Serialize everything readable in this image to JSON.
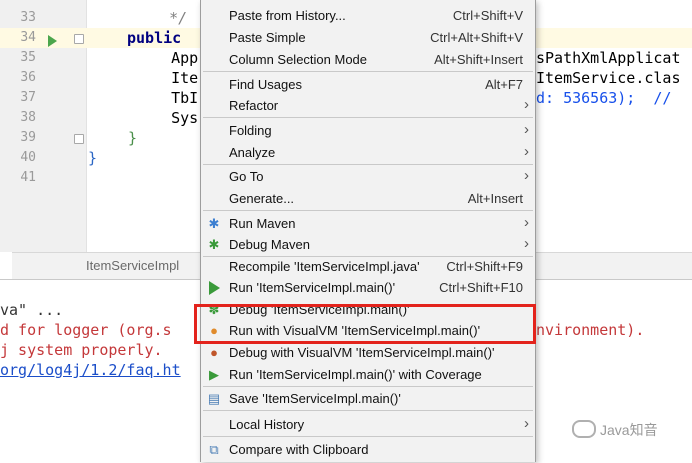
{
  "editor": {
    "lines": [
      {
        "num": "33",
        "code": "   */",
        "color": "#808080"
      },
      {
        "num": "34",
        "code": "public ",
        "color": "#000080"
      },
      {
        "num": "35",
        "code": "    App",
        "color": "#000000"
      },
      {
        "num": "36",
        "code": "    Ite",
        "color": "#000000"
      },
      {
        "num": "37",
        "code": "    TbI",
        "color": "#000000"
      },
      {
        "num": "38",
        "code": "    Sys",
        "color": "#000000"
      },
      {
        "num": "39",
        "code": "  }",
        "color": "#000000"
      },
      {
        "num": "40",
        "code": "}",
        "color": "#000000"
      },
      {
        "num": "41",
        "code": "",
        "color": "#000000"
      }
    ],
    "right_fragments": {
      "line35": "sPathXmlApplicat",
      "line36": "ItemService.clas",
      "line37": "d: 536563);  //"
    },
    "breadcrumb": "ItemServiceImpl"
  },
  "console": {
    "lines": [
      {
        "text": "va\" ...",
        "kind": "normal"
      },
      {
        "text": "d for logger (org.s",
        "kind": "error"
      },
      {
        "text": "j system properly.",
        "kind": "error"
      },
      {
        "text": "org/log4j/1.2/faq.ht",
        "kind": "link"
      }
    ],
    "right_fragment": "nvironment)."
  },
  "context_menu": {
    "items": [
      {
        "label": "Paste from History...",
        "shortcut": "Ctrl+Shift+V"
      },
      {
        "label": "Paste Simple",
        "shortcut": "Ctrl+Alt+Shift+V"
      },
      {
        "label": "Column Selection Mode",
        "shortcut": "Alt+Shift+Insert"
      },
      {
        "label": "Find Usages",
        "shortcut": "Alt+F7"
      },
      {
        "label": "Refactor",
        "shortcut": ""
      },
      {
        "label": "Folding",
        "shortcut": ""
      },
      {
        "label": "Analyze",
        "shortcut": ""
      },
      {
        "label": "Go To",
        "shortcut": ""
      },
      {
        "label": "Generate...",
        "shortcut": "Alt+Insert"
      },
      {
        "label": "Run Maven",
        "shortcut": ""
      },
      {
        "label": "Debug Maven",
        "shortcut": ""
      },
      {
        "label": "Recompile 'ItemServiceImpl.java'",
        "shortcut": "Ctrl+Shift+F9"
      },
      {
        "label": "Run 'ItemServiceImpl.main()'",
        "shortcut": "Ctrl+Shift+F10"
      },
      {
        "label": "Debug 'ItemServiceImpl.main()'",
        "shortcut": ""
      },
      {
        "label": "Run with VisualVM 'ItemServiceImpl.main()'",
        "shortcut": ""
      },
      {
        "label": "Debug with VisualVM 'ItemServiceImpl.main()'",
        "shortcut": ""
      },
      {
        "label": "Run 'ItemServiceImpl.main()' with Coverage",
        "shortcut": ""
      },
      {
        "label": "Save 'ItemServiceImpl.main()'",
        "shortcut": ""
      },
      {
        "label": "Local History",
        "shortcut": ""
      },
      {
        "label": "Compare with Clipboard",
        "shortcut": ""
      }
    ],
    "highlight_color": "#e3231c"
  },
  "watermark": {
    "text": "Java知音"
  }
}
